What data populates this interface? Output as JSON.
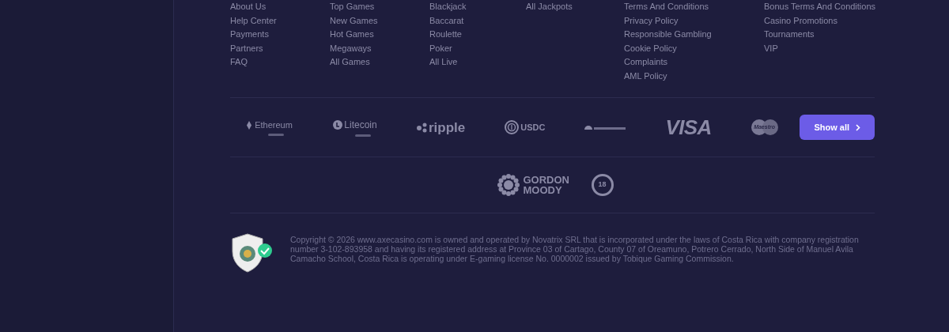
{
  "link_columns": [
    {
      "links": [
        "About Us",
        "Help Center",
        "Payments",
        "Partners",
        "FAQ"
      ]
    },
    {
      "links": [
        "Top Games",
        "New Games",
        "Hot Games",
        "Megaways",
        "All Games"
      ]
    },
    {
      "links": [
        "Blackjack",
        "Baccarat",
        "Roulette",
        "Poker",
        "All Live"
      ]
    },
    {
      "links": [
        "All Jackpots"
      ]
    },
    {
      "links": [
        "Terms And Conditions",
        "Privacy Policy",
        "Responsible Gambling",
        "Cookie Policy",
        "Complaints",
        "AML Policy"
      ]
    },
    {
      "links": [
        "Bonus Terms And Conditions",
        "Casino Promotions",
        "Tournaments",
        "VIP"
      ]
    }
  ],
  "payment_methods": [
    {
      "kind": "ethereum",
      "name": "Ethereum"
    },
    {
      "kind": "litecoin",
      "name": "Litecoin"
    },
    {
      "kind": "ripple",
      "name": "ripple"
    },
    {
      "kind": "usdc",
      "name": "USDC"
    },
    {
      "kind": "dogecoin"
    },
    {
      "kind": "visa",
      "name": "VISA"
    },
    {
      "kind": "maestro",
      "name": "Maestro"
    }
  ],
  "show_all_button": "Show all",
  "partners": [
    {
      "kind": "gordon",
      "name": "GORDON MOODY"
    },
    {
      "kind": "age",
      "name": "18"
    }
  ],
  "copyright": "Copyright © 2026 www.axecasino.com is owned and operated by Novatrix SRL that is incorporated under the laws of Costa Rica with company registration number 3-102-893958 and having its registered address at Province 03 of Cartago, County 07 of Oreamuno, Potrero Cerrado, North Side of Manuel Avila Camacho School, Costa Rica is operating under E-gaming license No. 0000002 issued by Tobique Gaming Commission."
}
